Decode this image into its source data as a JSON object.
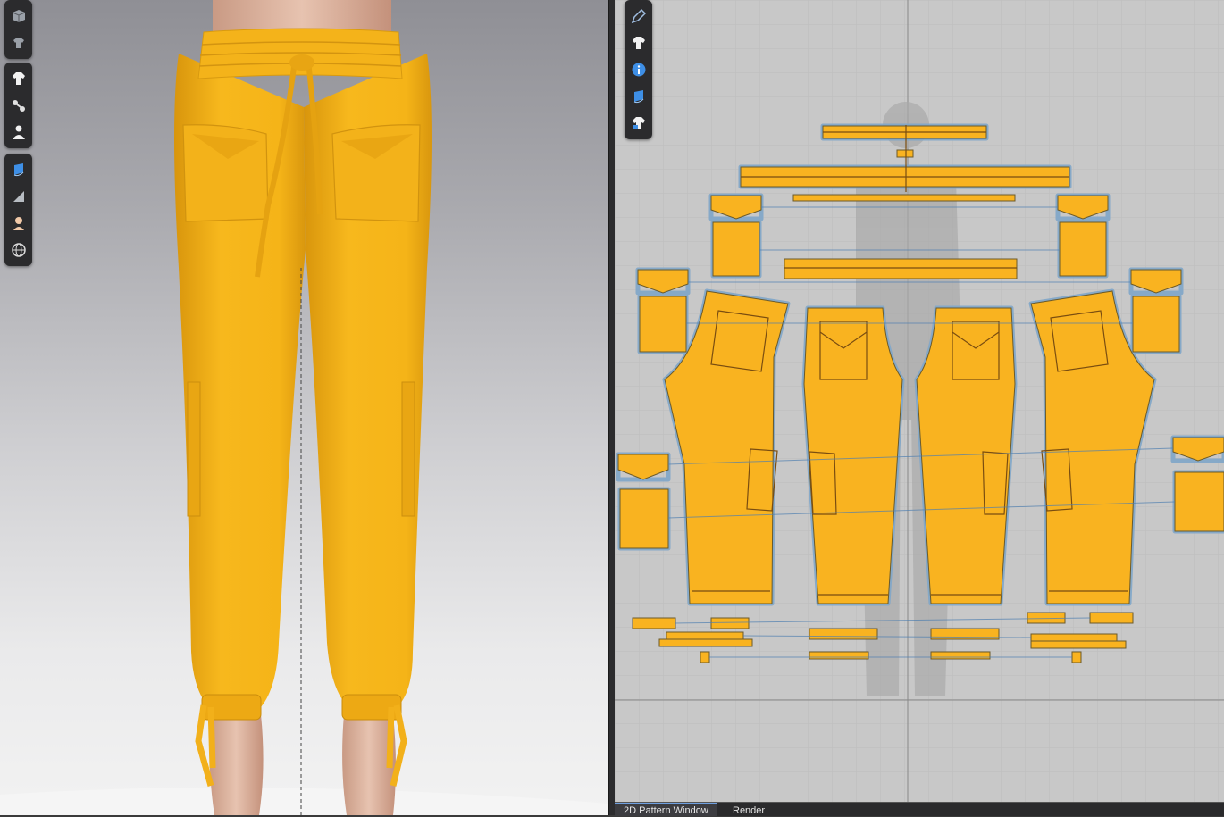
{
  "left_toolbar": {
    "group1": [
      "cube-icon",
      "avatar-garment-icon"
    ],
    "group2": [
      "shirt-icon",
      "sewing-icon",
      "avatar-icon"
    ],
    "group3": [
      "fabric-render-icon",
      "texture-icon",
      "skin-icon",
      "globe-icon"
    ]
  },
  "right_toolbar": [
    "pen-icon",
    "shirt-icon",
    "info-icon",
    "fabric-icon",
    "shirt-color-icon"
  ],
  "tabs": [
    {
      "label": "2D Pattern Window",
      "active": true
    },
    {
      "label": "Render",
      "active": false
    }
  ],
  "colors": {
    "garment": "#f6b619",
    "garment_shade": "#d9980f",
    "pattern_fill": "#f9b320",
    "pattern_outline": "#7fa6c9",
    "canvas_bg": "#c8c8c8",
    "toolbar_bg": "#2b2b2d"
  }
}
